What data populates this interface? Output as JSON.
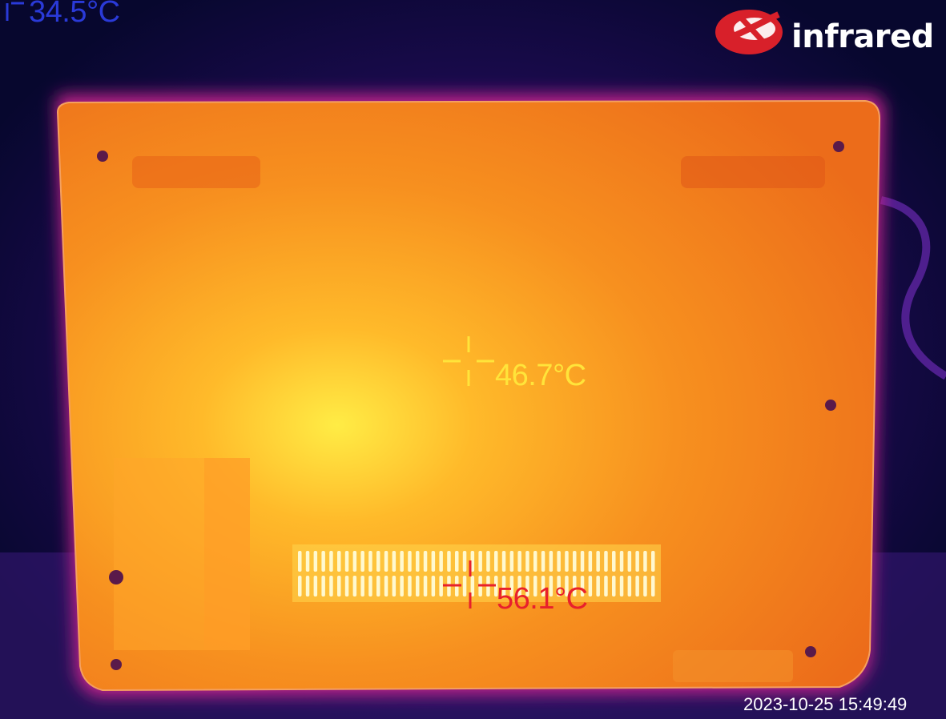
{
  "colors": {
    "background": "#0a0a3a",
    "laptop_body": "#f07a18",
    "hotspot": "#ffe840",
    "vent_slots": "#ffffe0",
    "min_marker": "#2a3ad8",
    "center_marker": "#ffe43a",
    "max_marker": "#e8202c",
    "brand": "#d8202a"
  },
  "readings": {
    "min_temp": "34.5°C",
    "center_temp": "46.7°C",
    "max_temp": "56.1°C"
  },
  "brand": {
    "icon": "infrared-logo-icon",
    "text": "infrared"
  },
  "timestamp": "2023-10-25 15:49:49"
}
